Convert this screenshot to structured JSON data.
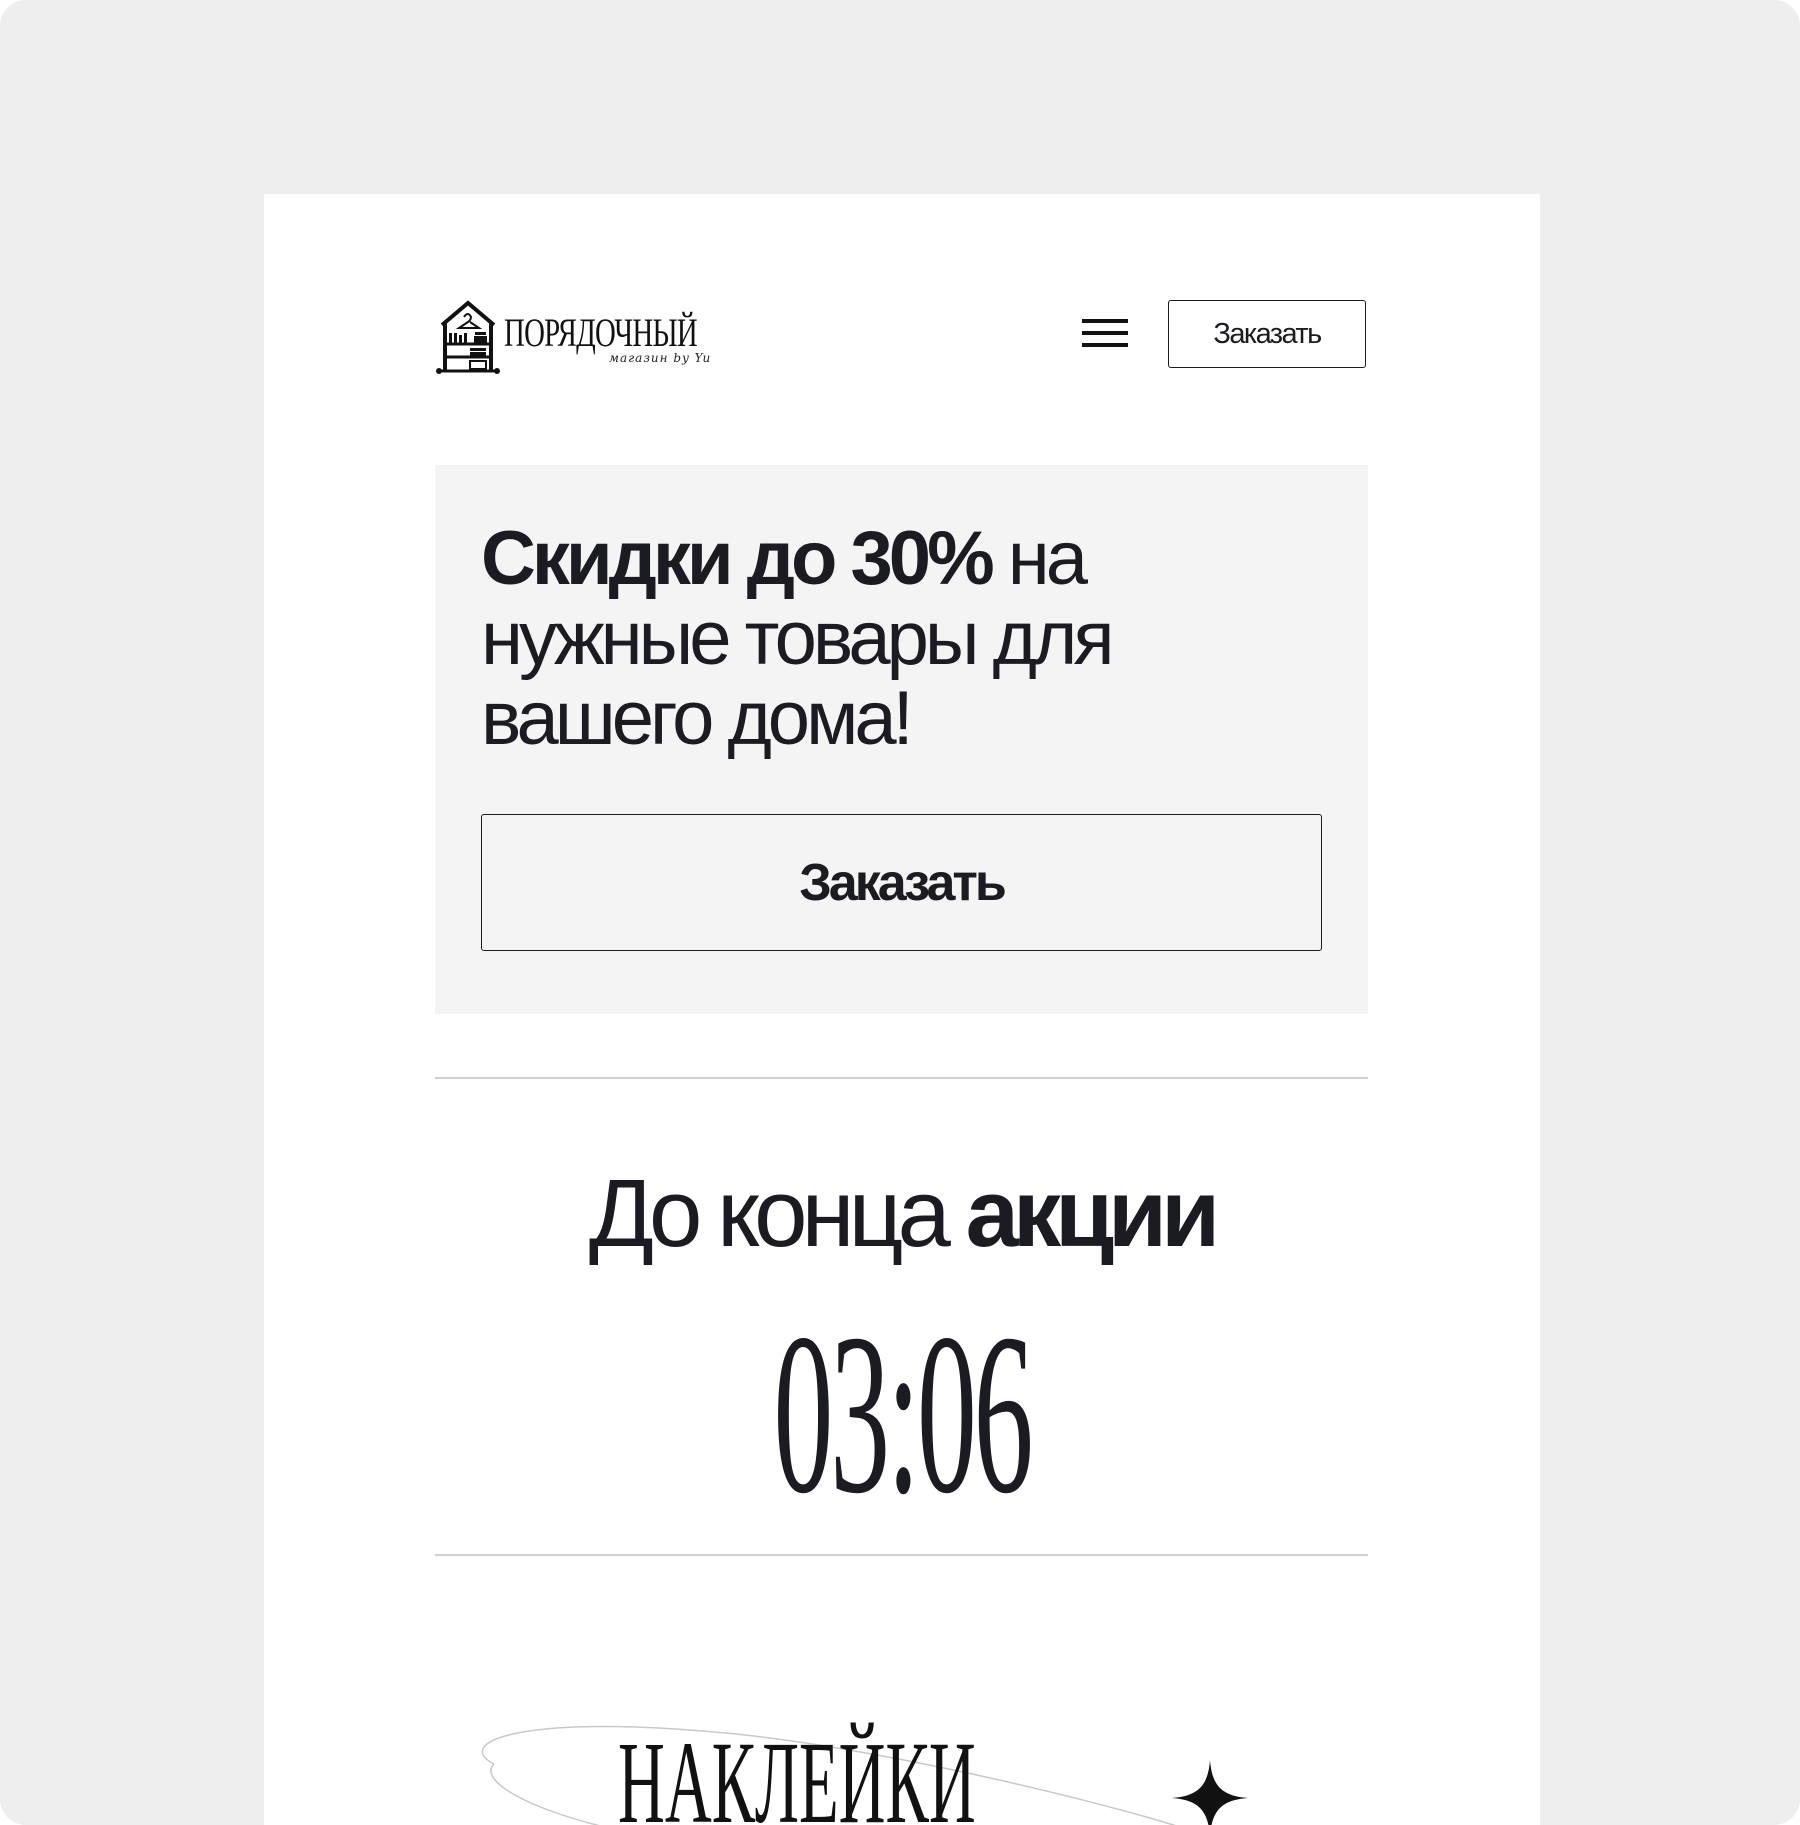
{
  "header": {
    "logo_title": "ПОРЯДОЧНЫЙ",
    "logo_subtitle": "магазин by Yu",
    "menu_icon": "hamburger-menu-icon",
    "order_label": "Заказать"
  },
  "promo": {
    "headline_bold": "Скидки до 30%",
    "headline_rest": " на нужные товары для вашего дома!",
    "order_label": "Заказать",
    "background": "#f4f4f4"
  },
  "countdown": {
    "label_regular": "До конца ",
    "label_bold": "акции",
    "value": "03:06"
  },
  "stickers": {
    "title": "НАКЛЕЙКИ",
    "icon": "sparkle-icon"
  },
  "colors": {
    "frame": "#eeeeee",
    "text": "#1b1b22",
    "divider": "#d0d0d0"
  }
}
